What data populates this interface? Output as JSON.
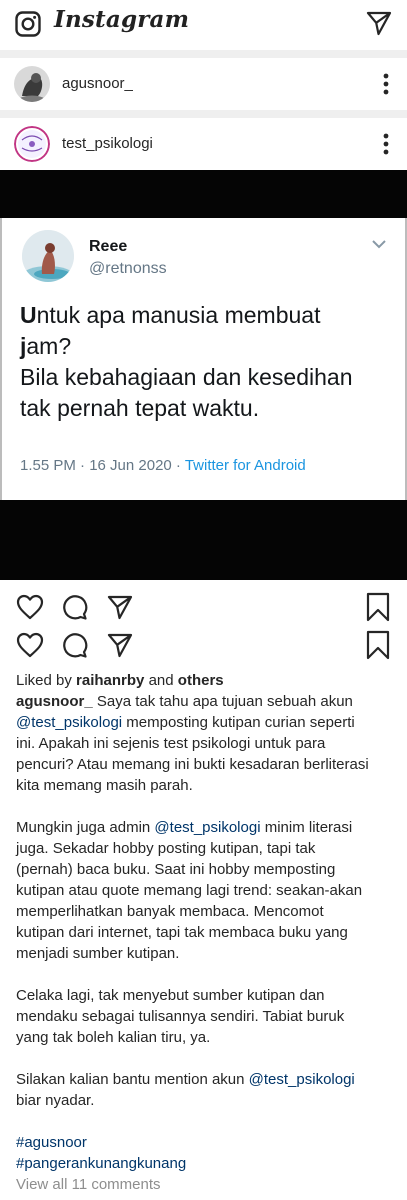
{
  "app": {
    "brand": "Instagram"
  },
  "feed_header_user": {
    "username": "agusnoor_"
  },
  "post_header": {
    "username": "test_psikologi",
    "avatar_text": "Test Psikologi"
  },
  "tweet": {
    "name": "Reee",
    "handle": "@retnonss",
    "body_lines": [
      {
        "first": "U",
        "rest": "ntuk apa manusia membuat"
      },
      {
        "first": "j",
        "rest": "am?"
      },
      {
        "first": "",
        "rest": "Bila kebahagiaan dan kesedihan"
      },
      {
        "first": "",
        "rest": "tak pernah tepat waktu."
      }
    ],
    "time": "1.55 PM · 16 Jun 2020 · ",
    "source": "Twitter for Android"
  },
  "caption": {
    "liked_prefix": "Liked by ",
    "liked_user": "raihanrby",
    "liked_and": " and ",
    "liked_others": "others",
    "author": "agusnoor_",
    "para1": [
      {
        "pre": "",
        "author": true,
        "text": "  Saya tak tahu apa tujuan sebuah akun"
      },
      {
        "mention": "@test_psikologi",
        "text": " memposting kutipan curian seperti"
      },
      {
        "text": "ini. Apakah ini sejenis test psikologi untuk para"
      },
      {
        "text": "pencuri? Atau memang ini bukti kesadaran berliterasi"
      },
      {
        "text": "kita memang masih parah."
      }
    ],
    "para2": [
      {
        "text": "Mungkin juga admin ",
        "mention": "@test_psikologi",
        "after": " minim literasi"
      },
      {
        "text": "juga. Sekadar hobby posting kutipan, tapi tak"
      },
      {
        "text": "(pernah) baca buku. Saat ini hobby memposting"
      },
      {
        "text": "kutipan atau quote memang lagi trend: seakan-akan"
      },
      {
        "text": "memperlihatkan banyak membaca. Mencomot"
      },
      {
        "text": "kutipan dari internet, tapi tak membaca buku yang"
      },
      {
        "text": "menjadi sumber kutipan."
      }
    ],
    "para3": [
      {
        "text": "Celaka lagi, tak menyebut sumber kutipan dan"
      },
      {
        "text": "mendaku sebagai tulisannya sendiri. Tabiat buruk"
      },
      {
        "text": "yang tak boleh kalian tiru, ya."
      }
    ],
    "para4": [
      {
        "text": "Silakan kalian bantu mention akun ",
        "mention": "@test_psikologi"
      },
      {
        "text": "biar nyadar."
      }
    ],
    "hashtags": [
      "#agusnoor",
      "#pangerankunangkunang"
    ],
    "view_all": "View all 11 comments"
  },
  "colors": {
    "link": "#003569",
    "twitter_blue": "#1b95e0",
    "twitter_grey": "#657786",
    "separator": "#efefef"
  },
  "icons": [
    "camera-icon",
    "direct-message-icon",
    "more-icon",
    "heart-icon",
    "comment-icon",
    "share-icon",
    "bookmark-icon",
    "chevron-down-icon"
  ]
}
